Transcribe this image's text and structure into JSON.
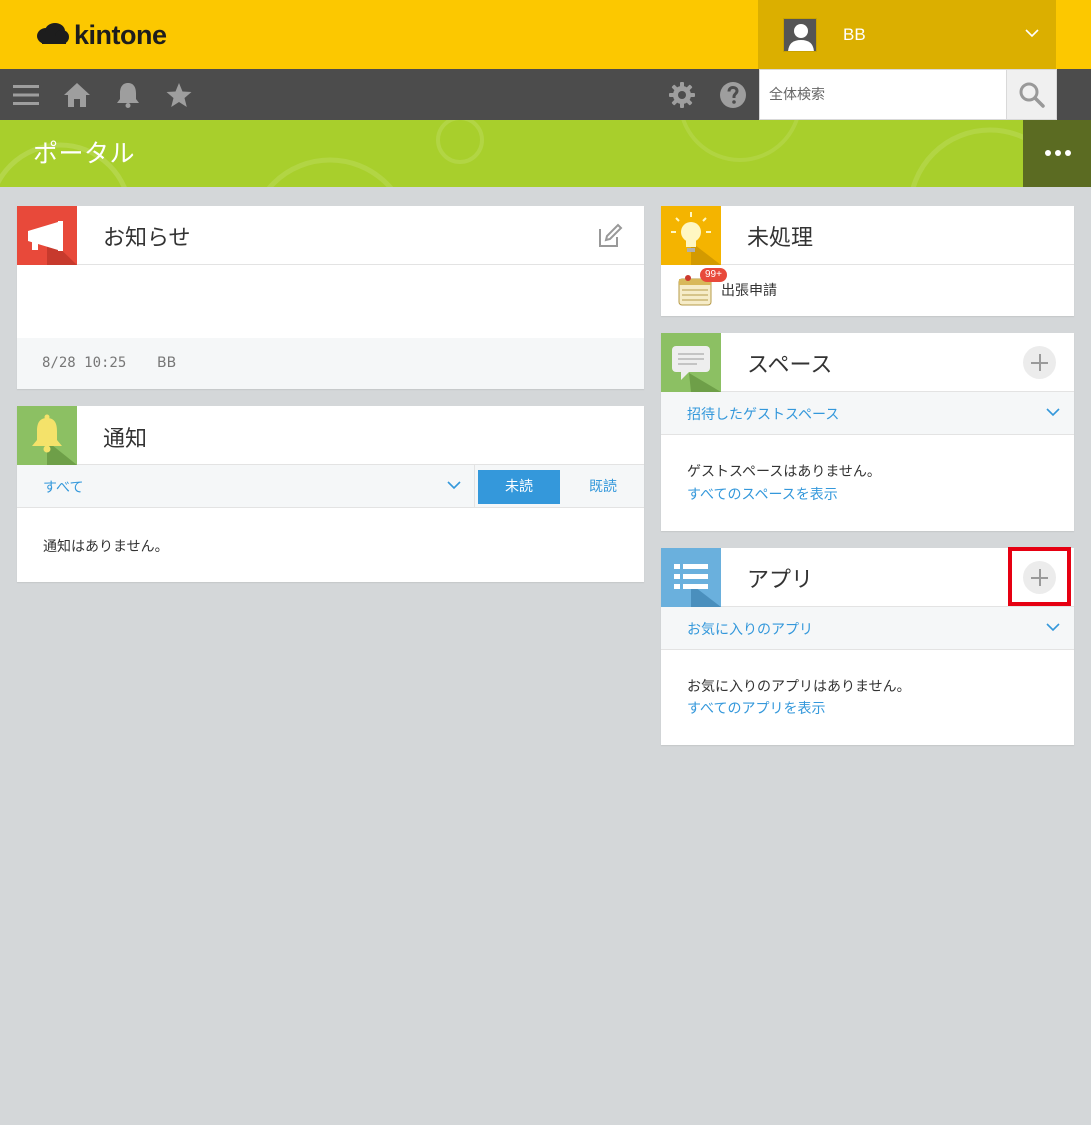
{
  "header": {
    "logo_text": "kintone",
    "user_name": "BB"
  },
  "toolbar": {
    "search_placeholder": "全体検索"
  },
  "banner": {
    "title": "ポータル"
  },
  "announcement": {
    "title": "お知らせ",
    "date": "8/28 10:25",
    "author": "BB"
  },
  "notifications": {
    "title": "通知",
    "filter_label": "すべて",
    "tab_unread": "未読",
    "tab_read": "既読",
    "empty_message": "通知はありません。"
  },
  "unprocessed": {
    "title": "未処理",
    "items": [
      {
        "name": "出張申請",
        "badge": "99+"
      }
    ]
  },
  "spaces": {
    "title": "スペース",
    "filter_label": "招待したゲストスペース",
    "empty_message": "ゲストスペースはありません。",
    "view_all_link": "すべてのスペースを表示"
  },
  "apps": {
    "title": "アプリ",
    "filter_label": "お気に入りのアプリ",
    "empty_message": "お気に入りのアプリはありません。",
    "view_all_link": "すべてのアプリを表示"
  },
  "colors": {
    "header_yellow": "#fcc800",
    "user_area": "#dbaf00",
    "toolbar": "#4c4c4c",
    "banner_green": "#a8cf2c",
    "link_blue": "#3498db",
    "announcement_icon": "#e8493a",
    "notification_icon": "#8cc063",
    "unprocessed_icon": "#f4b400",
    "space_icon": "#8cc063",
    "app_icon": "#6ab0dd",
    "highlight_red": "#e60012"
  }
}
